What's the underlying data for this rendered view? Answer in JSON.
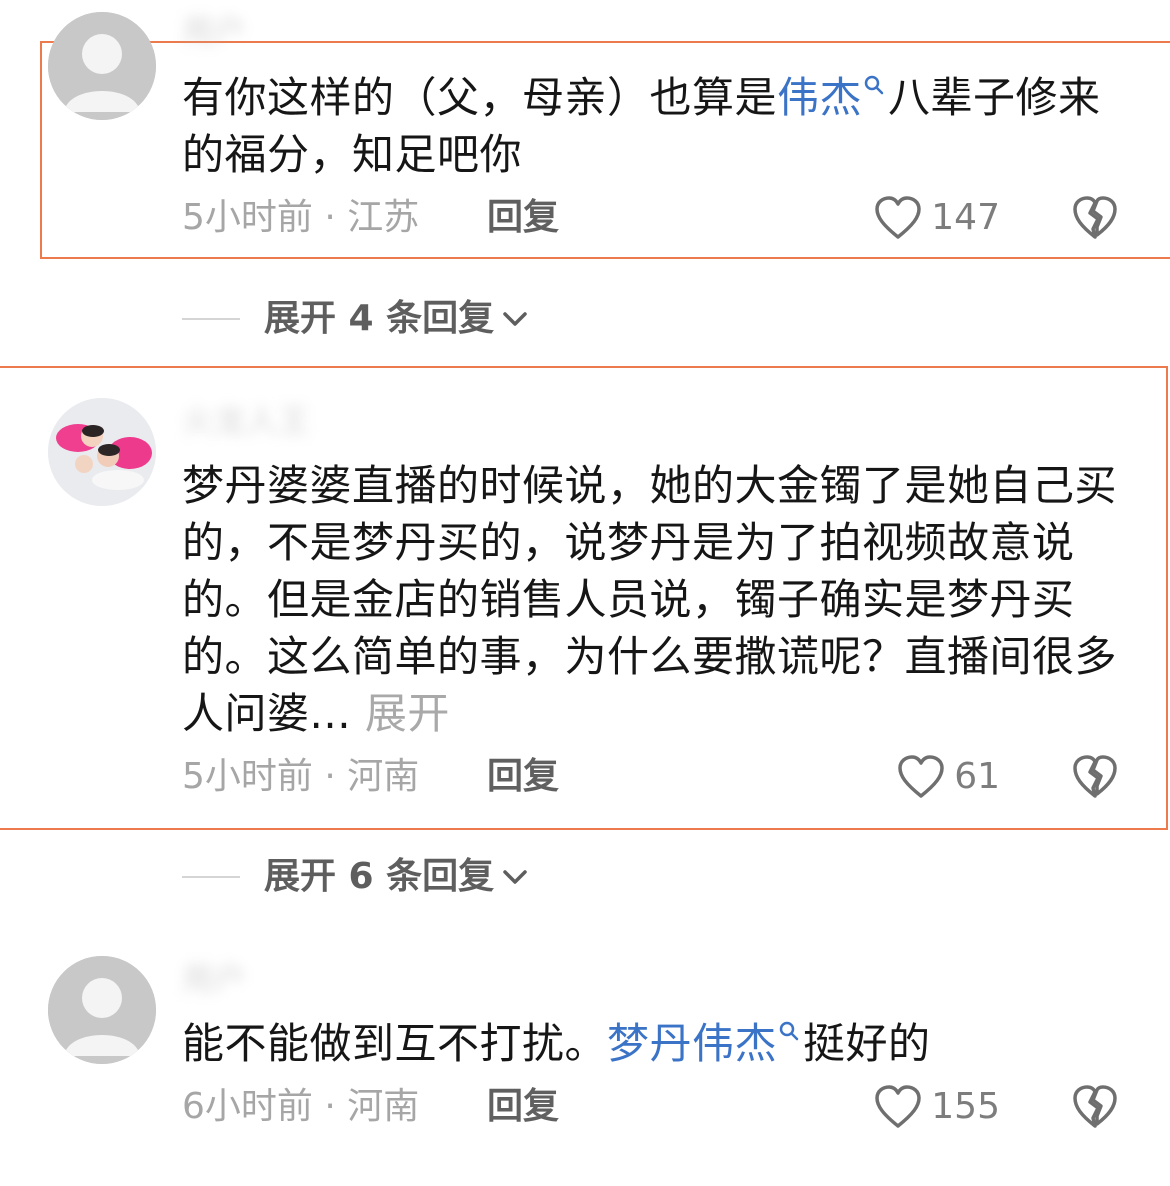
{
  "comments": [
    {
      "username": "用户",
      "text_before": "有你这样的（父，母亲）也算是",
      "mention": "伟杰",
      "text_after": "八辈子修来的福分，知足吧你",
      "time_location": "5小时前 · 江苏",
      "reply_label": "回复",
      "likes": "147"
    },
    {
      "username": "火龙人王",
      "text": "梦丹婆婆直播的时候说，她的大金镯了是她自己买的，不是梦丹买的，说梦丹是为了拍视频故意说的。但是金店的销售人员说，镯子确实是梦丹买的。这么简单的事，为什么要撒谎呢？直播间很多人问婆...",
      "more_label": "展开",
      "time_location": "5小时前 · 河南",
      "reply_label": "回复",
      "likes": "61"
    },
    {
      "username": "用户",
      "text_before": "能不能做到互不打扰。",
      "mention": "梦丹伟杰",
      "text_after": "挺好的",
      "time_location": "6小时前 · 河南",
      "reply_label": "回复",
      "likes": "155"
    }
  ],
  "expand_replies": [
    {
      "label": "展开 4 条回复"
    },
    {
      "label": "展开 6 条回复"
    }
  ],
  "colors": {
    "highlight_border": "#ec7a4c",
    "mention": "#3b73c7",
    "muted": "#a6a6a6"
  },
  "icons": {
    "like": "heart-outline-icon",
    "dislike": "broken-heart-icon",
    "expand": "chevron-down-icon",
    "mention": "search-icon",
    "avatar_placeholder": "default-avatar-icon"
  }
}
